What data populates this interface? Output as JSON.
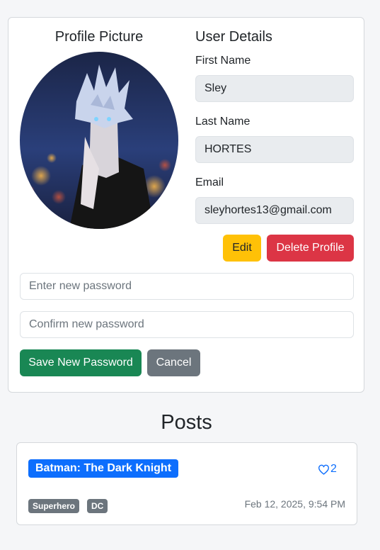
{
  "profile": {
    "picture_title": "Profile Picture",
    "details_title": "User Details",
    "first_name_label": "First Name",
    "first_name": "Sley",
    "last_name_label": "Last Name",
    "last_name": "HORTES",
    "email_label": "Email",
    "email": "sleyhortes13@gmail.com",
    "edit_label": "Edit",
    "delete_label": "Delete Profile"
  },
  "password": {
    "new_placeholder": "Enter new password",
    "confirm_placeholder": "Confirm new password",
    "save_label": "Save New Password",
    "cancel_label": "Cancel"
  },
  "posts": {
    "title": "Posts",
    "items": [
      {
        "title": "Batman: The Dark Knight",
        "likes": "2",
        "tags": [
          "Superhero",
          "DC"
        ],
        "date": "Feb 12, 2025, 9:54 PM"
      }
    ]
  },
  "colors": {
    "edit": "#ffc107",
    "delete": "#dc3545",
    "save": "#198754",
    "cancel": "#6c757d",
    "post_title": "#0d6efd",
    "tag": "#6c757d"
  },
  "icons": {
    "like": "heart-icon"
  }
}
